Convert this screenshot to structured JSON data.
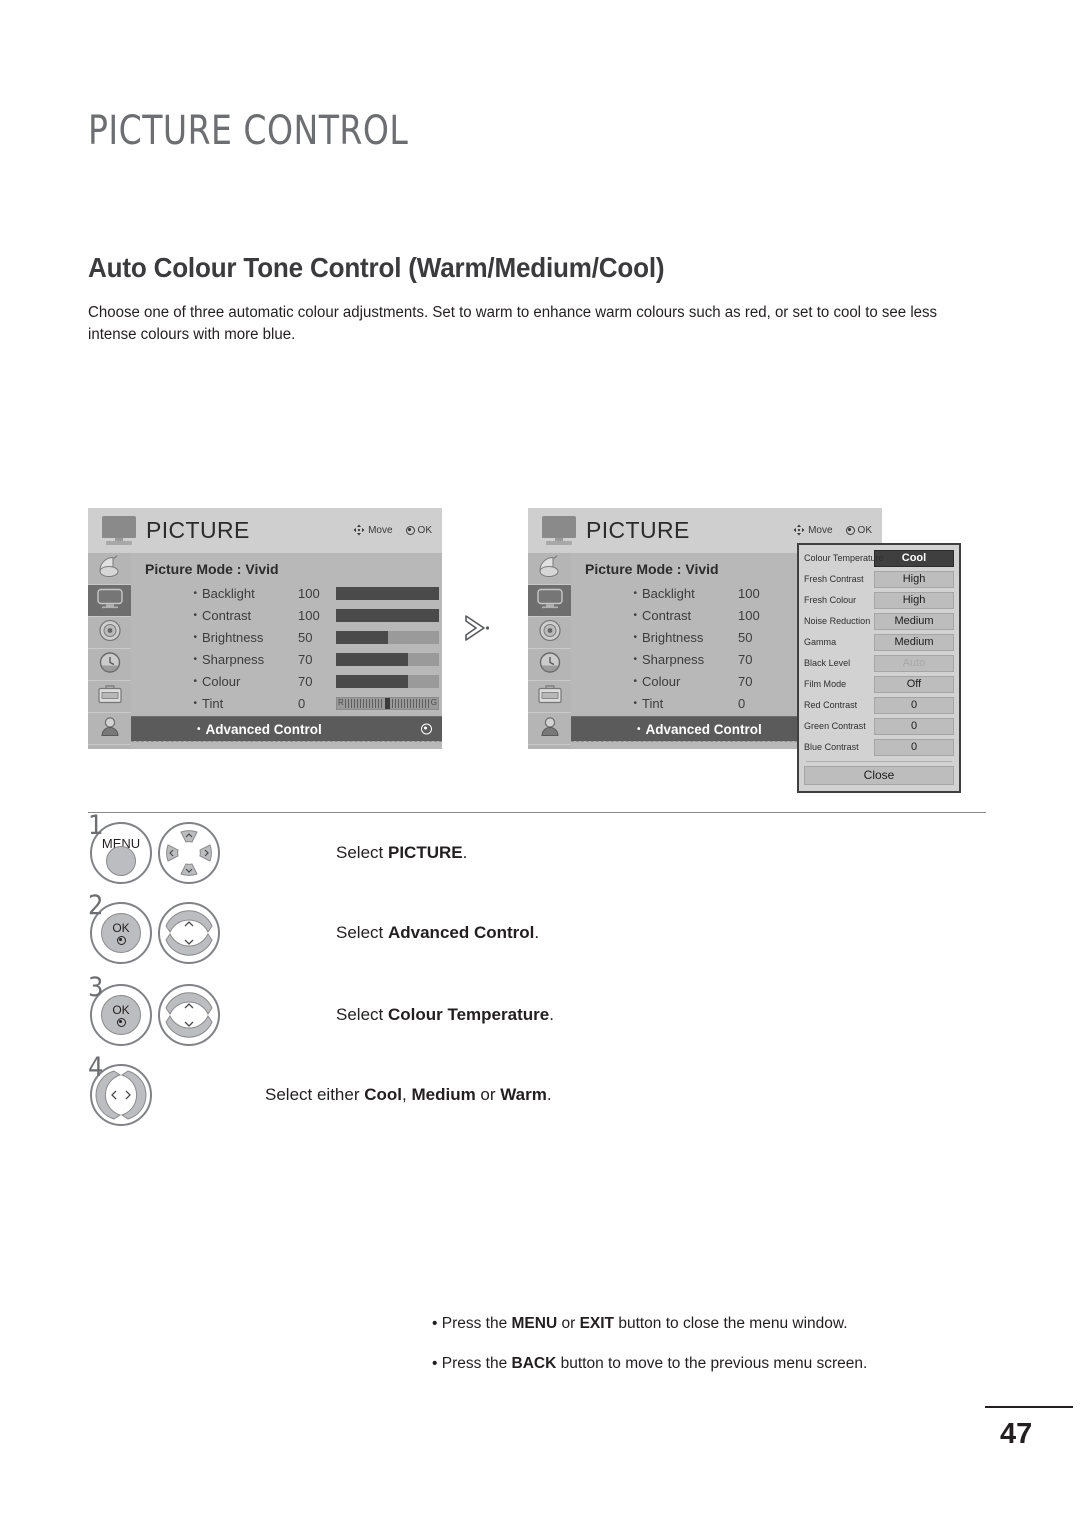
{
  "page": {
    "chapter_title": "PICTURE CONTROL",
    "section_title": "Auto Colour Tone Control (Warm/Medium/Cool)",
    "section_description": "Choose one of three automatic colour adjustments. Set to warm to enhance warm colours such as red, or set to cool to see less intense colours with more blue.",
    "page_number": "47"
  },
  "osd": {
    "title": "PICTURE",
    "hint_move": "Move",
    "hint_ok": "OK",
    "sidebar_icons": [
      "satellite-dish-icon",
      "tv-picture-icon",
      "audio-speaker-icon",
      "clock-time-icon",
      "setup-toolbox-icon",
      "lock-parental-icon"
    ],
    "picture_mode_label": "Picture Mode",
    "picture_mode_separator": ":",
    "picture_mode_value": "Vivid",
    "options": [
      {
        "label": "Backlight",
        "value": "100",
        "percent": 100
      },
      {
        "label": "Contrast",
        "value": "100",
        "percent": 100
      },
      {
        "label": "Brightness",
        "value": "50",
        "percent": 50
      },
      {
        "label": "Sharpness",
        "value": "70",
        "percent": 70
      },
      {
        "label": "Colour",
        "value": "70",
        "percent": 70
      }
    ],
    "tint": {
      "label": "Tint",
      "value": "0",
      "left_letter": "R",
      "right_letter": "G"
    },
    "advanced_control_label": "Advanced Control"
  },
  "advanced_popup": {
    "items": [
      {
        "key": "Colour Temperature",
        "value": "Cool",
        "selected": true,
        "disabled": false
      },
      {
        "key": "Fresh Contrast",
        "value": "High",
        "selected": false,
        "disabled": false
      },
      {
        "key": "Fresh Colour",
        "value": "High",
        "selected": false,
        "disabled": false
      },
      {
        "key": "Noise Reduction",
        "value": "Medium",
        "selected": false,
        "disabled": false
      },
      {
        "key": "Gamma",
        "value": "Medium",
        "selected": false,
        "disabled": false
      },
      {
        "key": "Black Level",
        "value": "Auto",
        "selected": false,
        "disabled": true
      },
      {
        "key": "Film Mode",
        "value": "Off",
        "selected": false,
        "disabled": false
      },
      {
        "key": "Red Contrast",
        "value": "0",
        "selected": false,
        "disabled": false
      },
      {
        "key": "Green Contrast",
        "value": "0",
        "selected": false,
        "disabled": false
      },
      {
        "key": "Blue Contrast",
        "value": "0",
        "selected": false,
        "disabled": false
      }
    ],
    "close_label": "Close"
  },
  "steps": [
    {
      "number": "1",
      "button_label": "MENU",
      "button_type": "menu",
      "nav_type": "four-way",
      "text_plain_1": "Select ",
      "text_bold": "PICTURE",
      "text_plain_2": "."
    },
    {
      "number": "2",
      "button_label": "OK",
      "button_type": "ok",
      "nav_type": "up-down",
      "text_plain_1": "Select ",
      "text_bold": "Advanced Control",
      "text_plain_2": "."
    },
    {
      "number": "3",
      "button_label": "OK",
      "button_type": "ok",
      "nav_type": "up-down",
      "text_plain_1": "Select ",
      "text_bold": "Colour Temperature",
      "text_plain_2": "."
    },
    {
      "number": "4",
      "button_label": "",
      "button_type": "none",
      "nav_type": "left-right",
      "text_plain_1": "Select either ",
      "text_bold": "Cool",
      "text_mid_1": ", ",
      "text_bold_2": "Medium",
      "text_mid_2": " or ",
      "text_bold_3": "Warm",
      "text_plain_2": "."
    }
  ],
  "notes": [
    {
      "pre": "• Press the ",
      "b1": "MENU",
      "mid1": " or ",
      "b2": "EXIT",
      "post": " button to close the menu window."
    },
    {
      "pre": "• Press the ",
      "b1": "BACK",
      "mid1": "",
      "b2": "",
      "post": " button to move to the previous menu screen."
    }
  ],
  "colors": {
    "heading_grey": "#6d6e71",
    "osd_background": "#b8b8b8",
    "osd_highlight": "#5b5b5b",
    "popup_selected": "#3f3f3f",
    "text_dark": "#231f20"
  }
}
